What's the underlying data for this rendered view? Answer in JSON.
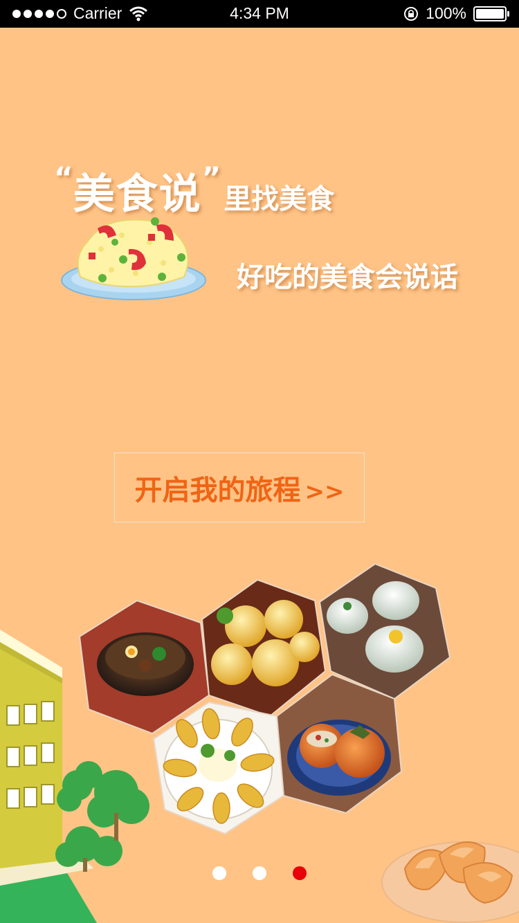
{
  "status_bar": {
    "carrier": "Carrier",
    "time": "4:34 PM",
    "battery": "100%"
  },
  "headline": {
    "open_quote": "“",
    "brand": "美食说",
    "close_quote": "”",
    "tail": "里找美食"
  },
  "subline": "好吃的美食会说话",
  "cta": {
    "label": "开启我的旅程",
    "arrow": ">>"
  },
  "pager": {
    "count": 3,
    "active_index": 2
  },
  "colors": {
    "background": "#FFC386",
    "cta_text": "#F06414",
    "pager_active": "#E8000A"
  }
}
